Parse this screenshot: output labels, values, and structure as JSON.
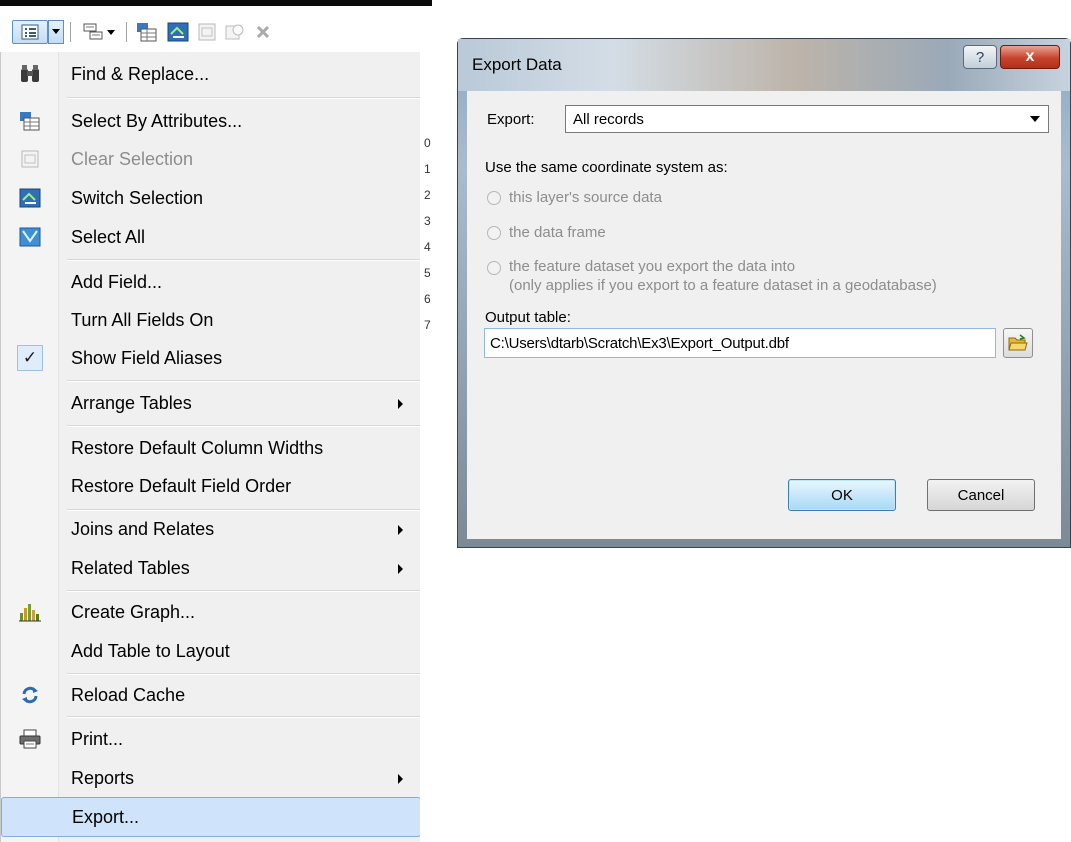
{
  "toolbar": {
    "icons": [
      "table-options-icon",
      "dropdown-arrow-icon",
      "related-tables-icon",
      "select-by-attributes-icon",
      "switch-selection-icon",
      "clear-selection-icon",
      "zoom-to-selected-icon",
      "delete-selected-icon"
    ]
  },
  "menu": {
    "items": [
      {
        "label": "Find & Replace...",
        "icon": "binoculars-icon"
      },
      {
        "label": "Select By Attributes...",
        "icon": "select-by-attributes-icon"
      },
      {
        "label": "Clear Selection",
        "icon": "clear-selection-icon"
      },
      {
        "label": "Switch Selection",
        "icon": "switch-selection-icon"
      },
      {
        "label": "Select All",
        "icon": "select-all-icon"
      },
      {
        "label": "Add Field..."
      },
      {
        "label": "Turn All Fields On"
      },
      {
        "label": "Show Field Aliases",
        "checked": true
      },
      {
        "label": "Arrange Tables"
      },
      {
        "label": "Restore Default Column Widths"
      },
      {
        "label": "Restore Default Field Order"
      },
      {
        "label": "Joins and Relates"
      },
      {
        "label": "Related Tables"
      },
      {
        "label": "Create Graph...",
        "icon": "bar-graph-icon"
      },
      {
        "label": "Add Table to Layout"
      },
      {
        "label": "Reload Cache",
        "icon": "reload-icon"
      },
      {
        "label": "Print...",
        "icon": "printer-icon"
      },
      {
        "label": "Reports"
      },
      {
        "label": "Export...",
        "selected": true
      }
    ],
    "check_mark": "✓"
  },
  "background_table": {
    "row_chars": [
      "0",
      "1",
      "2",
      "3",
      "4",
      "5",
      "6",
      "7"
    ]
  },
  "dialog": {
    "title": "Export Data",
    "help_button": "?",
    "close_button": "x",
    "export_label": "Export:",
    "export_value": "All records",
    "coord_label": "Use the same coordinate system as:",
    "radio_1": "this layer's source data",
    "radio_2": "the data frame",
    "radio_3_line1": "the feature dataset you export the data into",
    "radio_3_line2": "(only applies if you export to a feature dataset in a geodatabase)",
    "output_label": "Output table:",
    "output_value": "C:\\Users\\dtarb\\Scratch\\Ex3\\Export_Output.dbf",
    "ok_label": "OK",
    "cancel_label": "Cancel"
  },
  "colors": {
    "menu_highlight": "#cfe3fb",
    "menu_highlight_border": "#84acdd",
    "close_button": "#c6432c"
  }
}
